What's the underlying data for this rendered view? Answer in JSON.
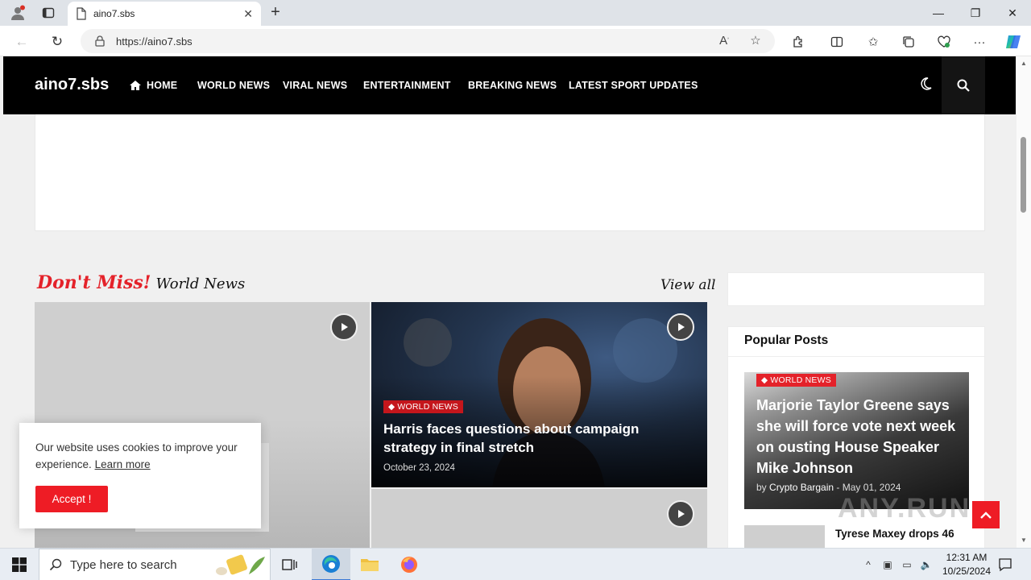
{
  "browser": {
    "tab_title": "aino7.sbs",
    "url": "https://aino7.sbs"
  },
  "site": {
    "logo": "aino7.sbs",
    "nav": [
      "HOME",
      "WORLD NEWS",
      "VIRAL NEWS",
      "ENTERTAINMENT",
      "BREAKING NEWS",
      "LATEST SPORT UPDATES"
    ]
  },
  "section": {
    "title_accent": "Don't Miss!",
    "title_main": "World News",
    "view_all": "View all"
  },
  "feature": {
    "category": "WORLD NEWS",
    "title": "Harris faces questions about campaign strategy in final stretch",
    "date": "October 23, 2024"
  },
  "popular": {
    "heading": "Popular Posts",
    "main_post": {
      "category": "WORLD NEWS",
      "title": "Marjorie Taylor Greene says she will force vote next week on ousting House Speaker Mike Johnson",
      "by": "by",
      "author": "Crypto Bargain",
      "separator": "-",
      "date": "May 01, 2024"
    },
    "second_post_title": "Tyrese Maxey drops 46"
  },
  "cookie": {
    "message": "Our website uses cookies to improve your experience.",
    "link": "Learn more",
    "button": "Accept !"
  },
  "watermark": "ANY.RUN",
  "taskbar": {
    "search_placeholder": "Type here to search",
    "time": "12:31 AM",
    "date": "10/25/2024"
  },
  "colors": {
    "accent_red": "#ee1c25",
    "badge_red": "#c4161c",
    "nav_bg": "#000000"
  },
  "icons": [
    "profile-icon",
    "tab-actions-icon",
    "page-icon",
    "close-icon",
    "plus-icon",
    "minimize-icon",
    "restore-icon",
    "back-icon",
    "refresh-icon",
    "lock-icon",
    "read-aloud-icon",
    "favorite-star-icon",
    "extensions-icon",
    "split-screen-icon",
    "favorites-icon",
    "collections-icon",
    "browser-essentials-icon",
    "more-icon",
    "copilot-icon",
    "home-icon",
    "moon-icon",
    "search-icon",
    "play-icon",
    "tag-icon",
    "chevron-up-icon",
    "windows-start-icon",
    "task-view-icon",
    "edge-icon",
    "file-explorer-icon",
    "firefox-icon",
    "notification-icon"
  ]
}
